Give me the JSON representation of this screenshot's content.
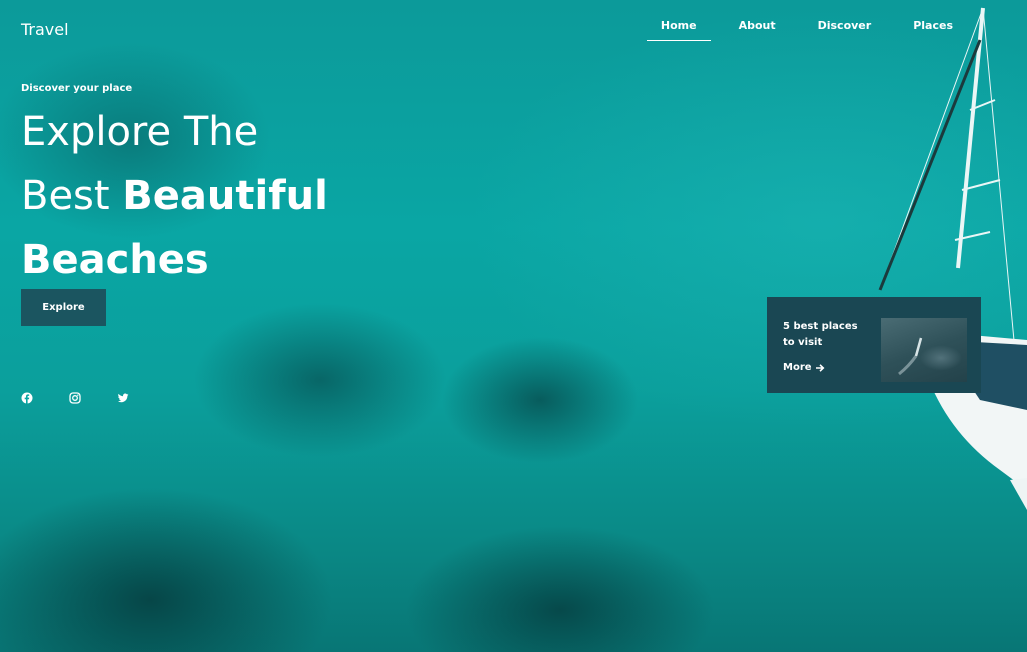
{
  "brand": "Travel",
  "nav": {
    "items": [
      {
        "label": "Home"
      },
      {
        "label": "About"
      },
      {
        "label": "Discover"
      },
      {
        "label": "Places"
      }
    ]
  },
  "hero": {
    "eyebrow": "Discover your place",
    "line1": "Explore The",
    "line2_regular": "Best ",
    "line2_bold": "Beautiful",
    "line3_bold": "Beaches",
    "button": "Explore"
  },
  "socials": [
    "facebook-icon",
    "instagram-icon",
    "twitter-icon"
  ],
  "card": {
    "title": "5 best places to visit",
    "link": "More"
  },
  "colors": {
    "sea": "#0aa6a4",
    "card": "#1a4753",
    "button": "#1b5560",
    "text": "#ffffff"
  }
}
